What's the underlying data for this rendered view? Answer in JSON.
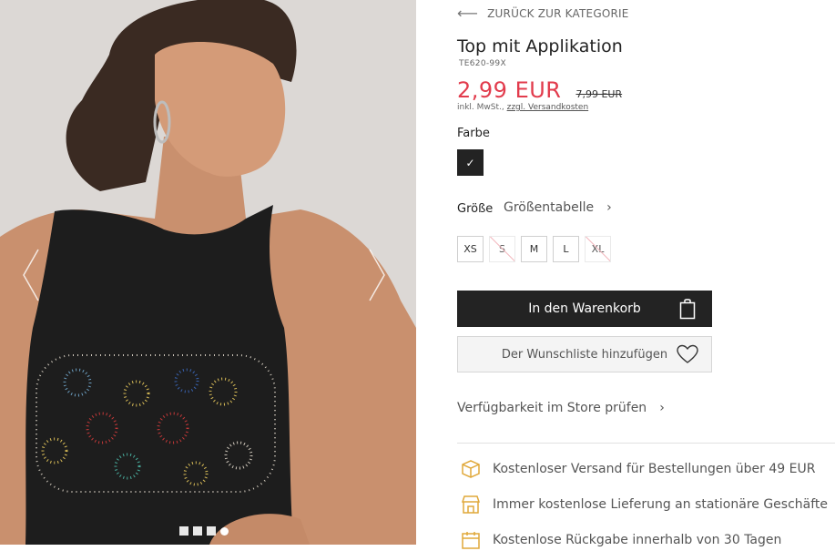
{
  "product_image": {
    "alt": "",
    "dots": 4,
    "active_dot": 3
  },
  "nav": {
    "back_label": "ZURÜCK ZUR KATEGORIE"
  },
  "product": {
    "title": "Top mit Applikation",
    "sku": "TE620-99X",
    "price": "2,99 EUR",
    "old_price": "7,99 EUR",
    "tax_prefix": "inkl. MwSt.,",
    "shipping_link": "zzgl. Versandkosten"
  },
  "color": {
    "label": "Farbe",
    "selected_check": "✓",
    "swatch_color": "#232323"
  },
  "size": {
    "label": "Größe",
    "chart_link": "Größentabelle",
    "options": [
      {
        "label": "XS",
        "available": true
      },
      {
        "label": "S",
        "available": false
      },
      {
        "label": "M",
        "available": true
      },
      {
        "label": "L",
        "available": true
      },
      {
        "label": "XL",
        "available": false
      }
    ]
  },
  "actions": {
    "add_to_cart": "In den Warenkorb",
    "add_to_wishlist": "Der Wunschliste hinzufügen",
    "check_store": "Verfügbarkeit im Store prüfen"
  },
  "benefits": [
    {
      "icon": "shipping-box-icon",
      "text": "Kostenloser Versand für Bestellungen über 49 EUR"
    },
    {
      "icon": "store-icon",
      "text": "Immer kostenlose Lieferung an stationäre Geschäfte"
    },
    {
      "icon": "calendar-return-icon",
      "text": "Kostenlose Rückgabe innerhalb von 30 Tagen"
    }
  ],
  "colors": {
    "accent": "#e23c4d",
    "icon_gold": "#e0a83a",
    "dark": "#232323"
  }
}
